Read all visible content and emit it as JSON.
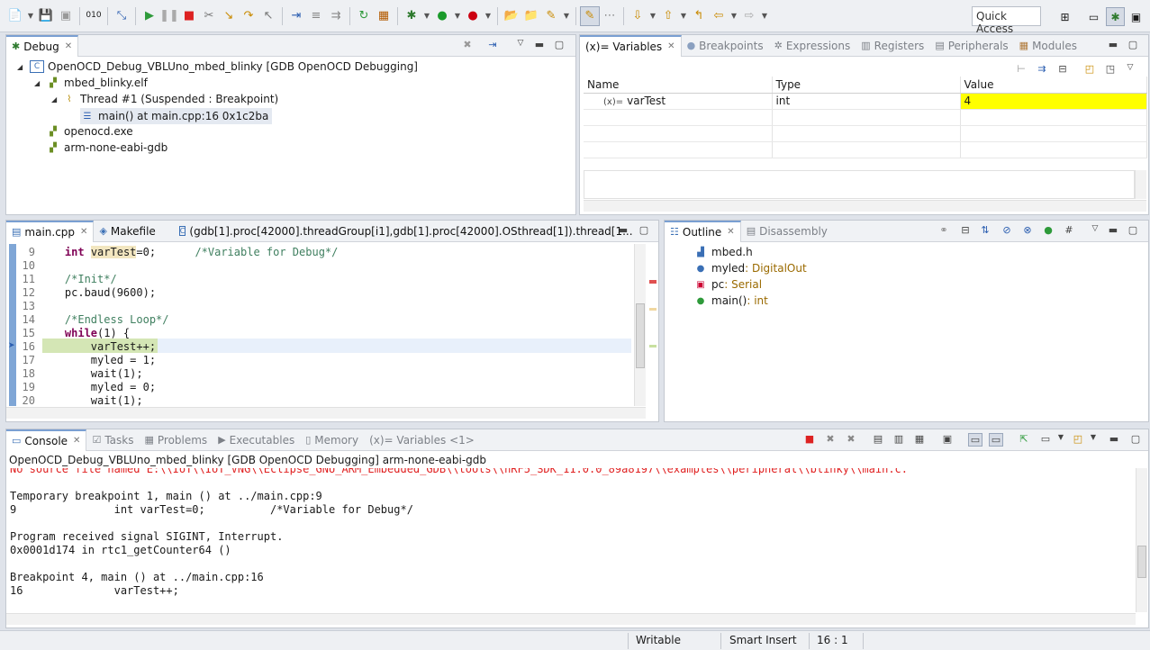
{
  "toolbar": {
    "quick_access": "Quick Access"
  },
  "debug_view": {
    "tab_label": "Debug",
    "tree": [
      {
        "label": "OpenOCD_Debug_VBLUno_mbed_blinky [GDB OpenOCD Debugging]"
      },
      {
        "label": "mbed_blinky.elf"
      },
      {
        "label": "Thread #1 (Suspended : Breakpoint)"
      },
      {
        "label": "main() at main.cpp:16 0x1c2ba"
      },
      {
        "label": "openocd.exe"
      },
      {
        "label": "arm-none-eabi-gdb"
      }
    ]
  },
  "variables_view": {
    "tabs": [
      "(x)= Variables",
      "Breakpoints",
      "Expressions",
      "Registers",
      "Peripherals",
      "Modules"
    ],
    "columns": [
      "Name",
      "Type",
      "Value"
    ],
    "rows": [
      {
        "name": "varTest",
        "type": "int",
        "value": "4"
      }
    ],
    "highlight_color": "#ffff00"
  },
  "editor": {
    "tabs": [
      "main.cpp",
      "Makefile",
      "(gdb[1].proc[42000].threadGroup[i1],gdb[1].proc[42000].OSthread[1]).thread[1..."
    ],
    "lines": [
      {
        "n": "9",
        "text": "    int varTest=0;      /*Variable for Debug*/"
      },
      {
        "n": "10",
        "text": ""
      },
      {
        "n": "11",
        "text": "    /*Init*/"
      },
      {
        "n": "12",
        "text": "    pc.baud(9600);"
      },
      {
        "n": "13",
        "text": ""
      },
      {
        "n": "14",
        "text": "    /*Endless Loop*/"
      },
      {
        "n": "15",
        "text": "    while(1) {"
      },
      {
        "n": "16",
        "text": "        varTest++;"
      },
      {
        "n": "17",
        "text": "        myled = 1;"
      },
      {
        "n": "18",
        "text": "        wait(1);"
      },
      {
        "n": "19",
        "text": "        myled = 0;"
      },
      {
        "n": "20",
        "text": "        wait(1);"
      }
    ],
    "current_line_color": "#d4e6b5"
  },
  "outline": {
    "tabs": [
      "Outline",
      "Disassembly"
    ],
    "items": [
      {
        "name": "mbed.h",
        "type": ""
      },
      {
        "name": "myled",
        "type": " : DigitalOut"
      },
      {
        "name": "pc",
        "type": " : Serial"
      },
      {
        "name": "main()",
        "type": " : int"
      }
    ]
  },
  "console": {
    "tabs": [
      "Console",
      "Tasks",
      "Problems",
      "Executables",
      "Memory",
      "(x)= Variables <1>"
    ],
    "header": "OpenOCD_Debug_VBLUno_mbed_blinky [GDB OpenOCD Debugging] arm-none-eabi-gdb",
    "error_line": "No source file named E:\\\\IoT\\\\IoT_VNG\\\\Eclipse_GNU_ARM_Embedded_GDB\\\\tools\\\\nRF5_SDK_11.0.0_89a8197\\\\examples\\\\peripheral\\\\blinky\\\\main.c.",
    "lines": [
      "Temporary breakpoint 1, main () at ../main.cpp:9",
      "9\t\tint varTest=0;\t\t/*Variable for Debug*/",
      "",
      "Program received signal SIGINT, Interrupt.",
      "0x0001d174 in rtc1_getCounter64 ()",
      "",
      "Breakpoint 4, main () at ../main.cpp:16",
      "16\t\tvarTest++;"
    ]
  },
  "status": {
    "writable": "Writable",
    "insert_mode": "Smart Insert",
    "position": "16 : 1"
  }
}
